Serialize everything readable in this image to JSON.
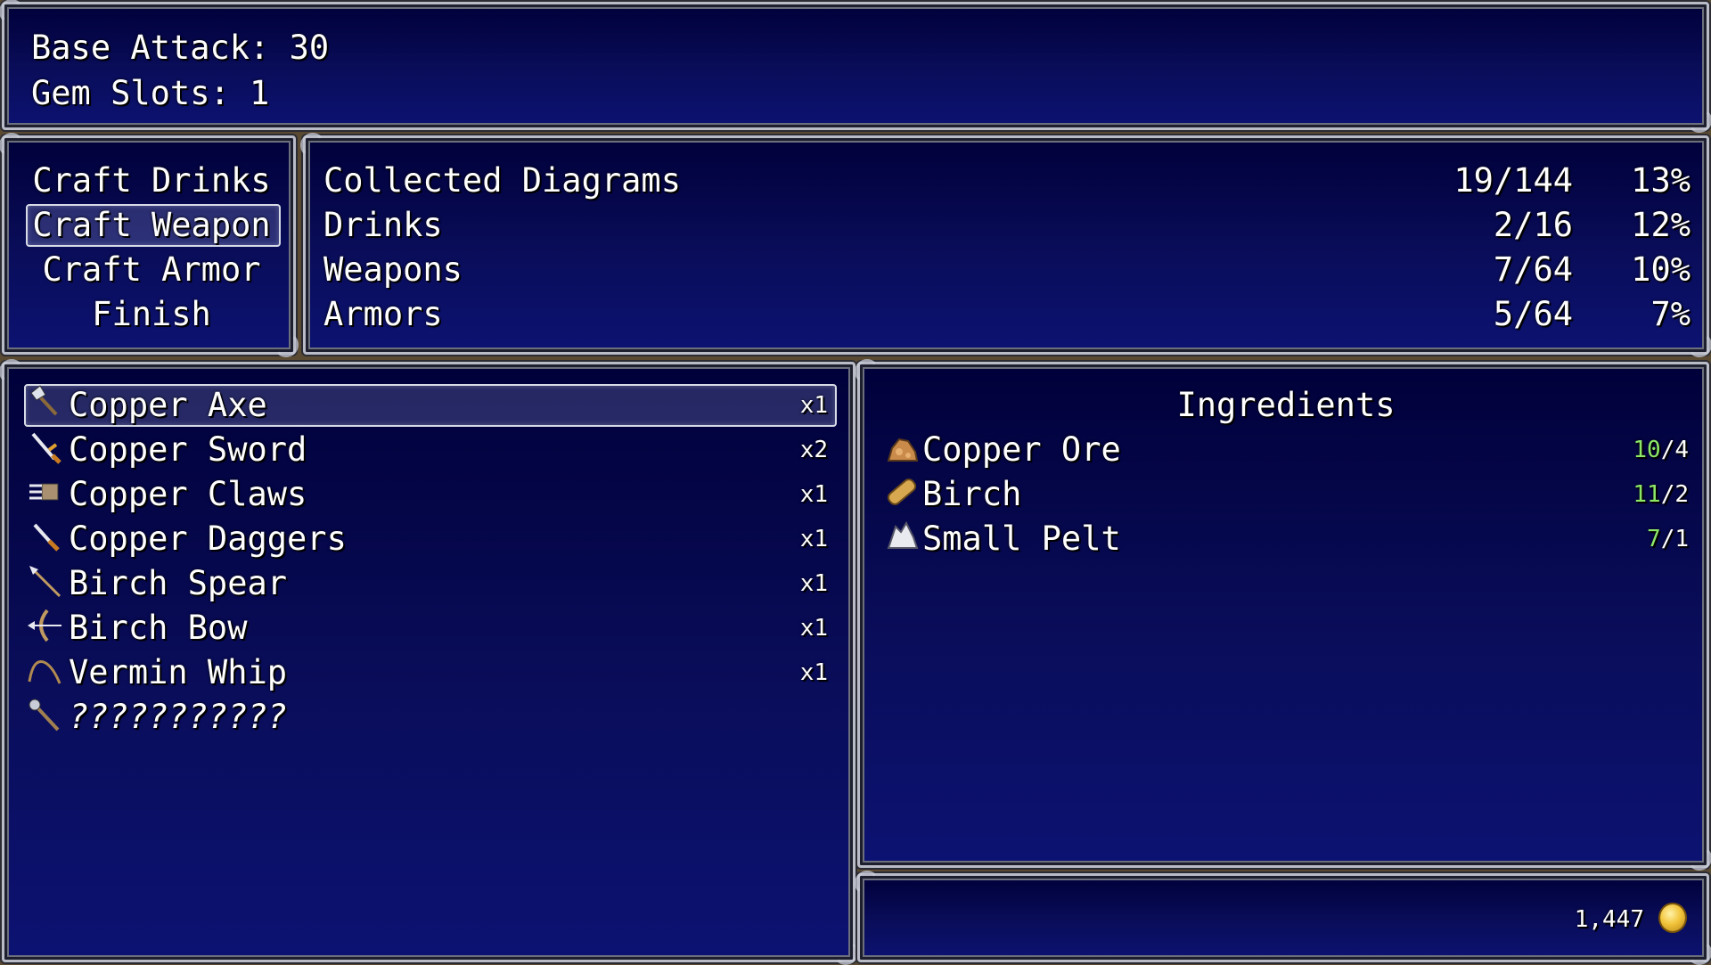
{
  "status": {
    "base_attack": "Base Attack: 30",
    "gem_slots": "Gem Slots: 1"
  },
  "commands": {
    "items": [
      "Craft Drinks",
      "Craft Weapon",
      "Craft Armor",
      "Finish"
    ],
    "selected": "Craft Weapon"
  },
  "diagrams": {
    "rows": [
      {
        "label": "Collected Diagrams",
        "count": "19/144",
        "percent": "13%"
      },
      {
        "label": "Drinks",
        "count": "2/16",
        "percent": "12%"
      },
      {
        "label": "Weapons",
        "count": "7/64",
        "percent": "10%"
      },
      {
        "label": "Armors",
        "count": "5/64",
        "percent": "7%"
      }
    ]
  },
  "recipes": {
    "items": [
      {
        "name": "Copper Axe",
        "qty": "x1",
        "icon": "axe-icon"
      },
      {
        "name": "Copper Sword",
        "qty": "x2",
        "icon": "sword-icon"
      },
      {
        "name": "Copper Claws",
        "qty": "x1",
        "icon": "claws-icon"
      },
      {
        "name": "Copper Daggers",
        "qty": "x1",
        "icon": "daggers-icon"
      },
      {
        "name": "Birch Spear",
        "qty": "x1",
        "icon": "spear-icon"
      },
      {
        "name": "Birch Bow",
        "qty": "x1",
        "icon": "bow-icon"
      },
      {
        "name": "Vermin Whip",
        "qty": "x1",
        "icon": "whip-icon"
      },
      {
        "name": "???????????",
        "qty": "",
        "icon": "staff-icon"
      }
    ],
    "selected": "Copper Axe"
  },
  "ingredients": {
    "title": "Ingredients",
    "items": [
      {
        "name": "Copper Ore",
        "have": "10",
        "need": "/4",
        "icon": "ore-icon"
      },
      {
        "name": "Birch",
        "have": "11",
        "need": "/2",
        "icon": "log-icon"
      },
      {
        "name": "Small Pelt",
        "have": "7",
        "need": "/1",
        "icon": "pelt-icon"
      }
    ]
  },
  "gold": {
    "amount": "1,447",
    "icon": "gold-coin-icon"
  },
  "colors": {
    "have_text": "#8de868",
    "window_top": "#00003a",
    "window_bottom": "#0c1272"
  }
}
